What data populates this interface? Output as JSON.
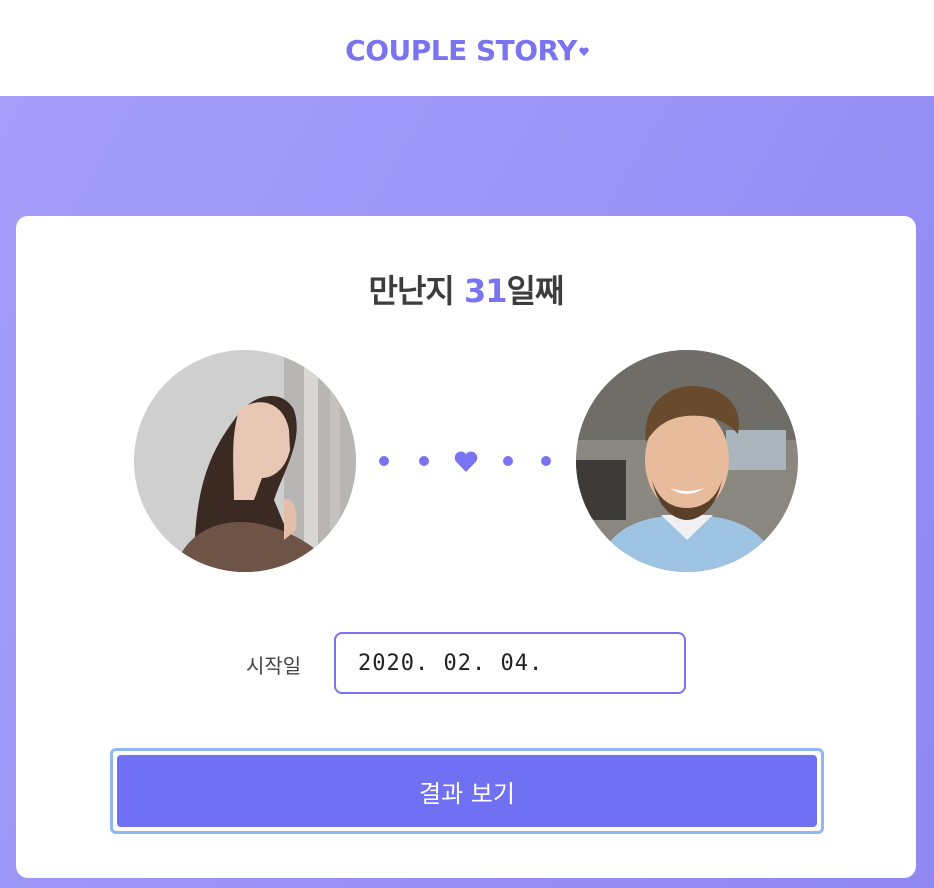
{
  "header": {
    "logo_text": "COUPLE STORY",
    "logo_icon": "heart-icon",
    "accent_color": "#7b74f0"
  },
  "card": {
    "title_prefix": "만난지 ",
    "days": "31",
    "title_suffix": "일째",
    "partner_left": {
      "icon": "woman-avatar"
    },
    "partner_right": {
      "icon": "man-avatar"
    },
    "connector_icon": "heart-icon",
    "start_label": "시작일",
    "start_date": "2020. 02. 04.",
    "submit_label": "결과 보기",
    "button_color": "#7070f3"
  }
}
